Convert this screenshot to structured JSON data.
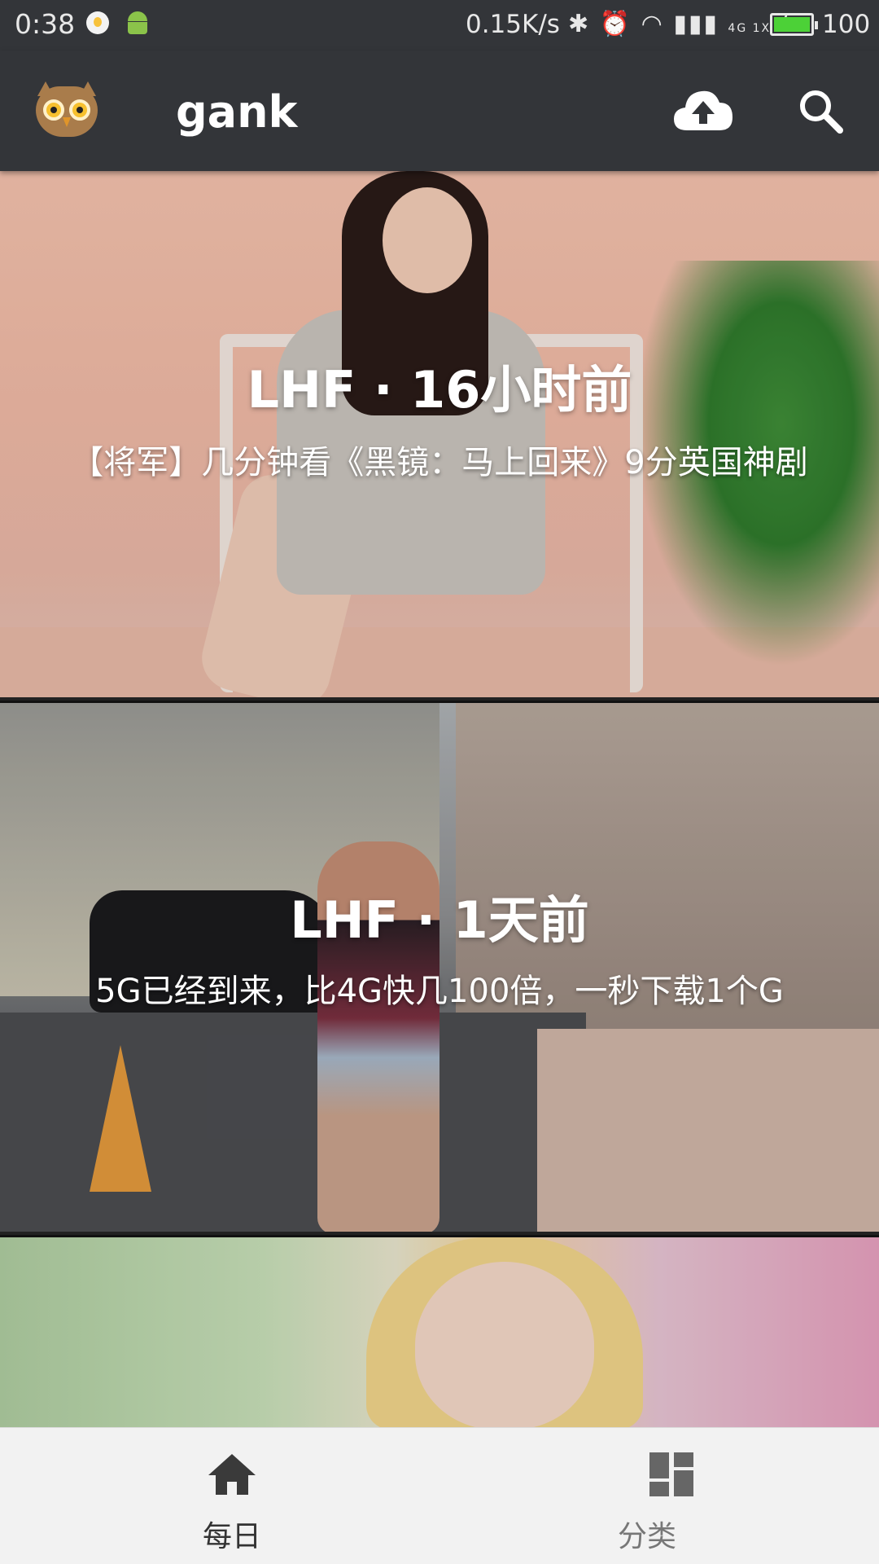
{
  "status_bar": {
    "time": "0:38",
    "speed": "0.15K/s",
    "network_label": "4G 1X",
    "battery": "100"
  },
  "toolbar": {
    "title": "gank"
  },
  "feed": {
    "items": [
      {
        "meta": "LHF · 16小时前",
        "desc": "【将军】几分钟看《黑镜：马上回来》9分英国神剧"
      },
      {
        "meta": "LHF · 1天前",
        "desc": "5G已经到来，比4G快几100倍，一秒下载1个G"
      },
      {
        "meta": "",
        "desc": ""
      }
    ]
  },
  "bottom_nav": {
    "items": [
      {
        "label": "每日",
        "icon": "home-icon",
        "active": true
      },
      {
        "label": "分类",
        "icon": "category-icon",
        "active": false
      }
    ]
  },
  "colors": {
    "toolbar": "#333539",
    "nav_background": "#f2f2f2",
    "battery_fill": "#4cd137"
  }
}
